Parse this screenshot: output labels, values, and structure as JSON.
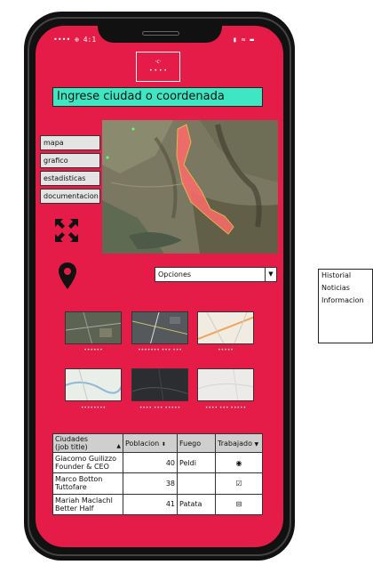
{
  "status_bar": {
    "time": "•••• ⊕ 4:1",
    "icons": "▮ ≈ ▬"
  },
  "logo": {
    "line1": "·c·",
    "line2": "• • • •"
  },
  "search": {
    "placeholder": "Ingrese ciudad o coordenada"
  },
  "nav": [
    {
      "label": "mapa"
    },
    {
      "label": "grafico"
    },
    {
      "label": "estadisticas"
    },
    {
      "label": "documentacion"
    }
  ],
  "dropdown": {
    "selected": "Opciones"
  },
  "basemaps": [
    {
      "label": "••••••"
    },
    {
      "label": "••••••• ••• •••"
    },
    {
      "label": "•••••"
    },
    {
      "label": "••••••••"
    },
    {
      "label": "•••• ••• •••••"
    },
    {
      "label": "•••• ••• •••••"
    }
  ],
  "table": {
    "headers": [
      "Ciudades\n(job title)",
      "Poblacion",
      "Fuego",
      "Trabajado"
    ],
    "rows": [
      {
        "name": "Giacomo Guilizzo\nFounder & CEO",
        "poblacion": "40",
        "fuego": "Peldi",
        "trabajado": "◉"
      },
      {
        "name": "Marco Botton\nTuttofare",
        "poblacion": "38",
        "fuego": "",
        "trabajado": "☑"
      },
      {
        "name": "Mariah Maclachl\nBetter Half",
        "poblacion": "41",
        "fuego": "Patata",
        "trabajado": "⊟"
      }
    ]
  },
  "side_panel": [
    {
      "label": "Historial"
    },
    {
      "label": "Noticias"
    },
    {
      "label": "Informacion"
    }
  ],
  "colors": {
    "screen": "#e51c47",
    "search": "#3ee6c2",
    "fire": "#ff6b6b"
  }
}
